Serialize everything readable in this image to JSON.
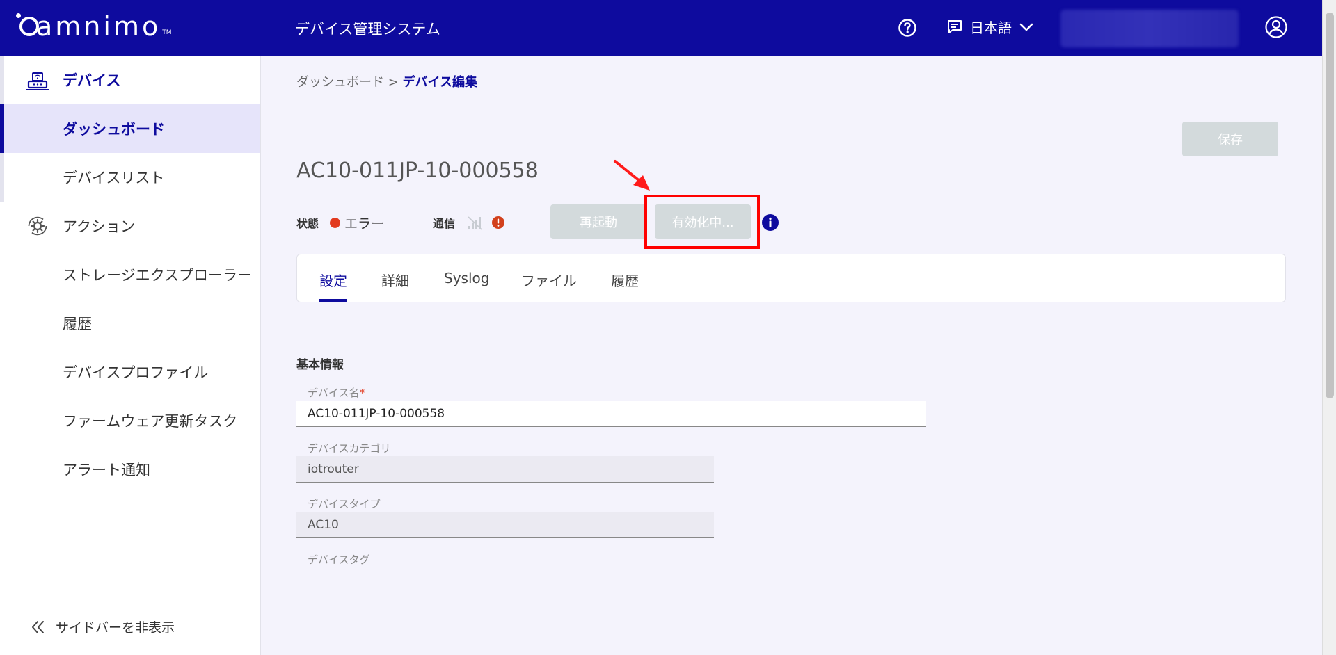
{
  "header": {
    "logo_text": "amnimo",
    "logo_tm": "TM",
    "app_title": "デバイス管理システム",
    "language": "日本語"
  },
  "sidebar": {
    "items": [
      {
        "label": "デバイス",
        "icon": "router-icon"
      },
      {
        "label": "ダッシュボード"
      },
      {
        "label": "デバイスリスト"
      },
      {
        "label": "アクション",
        "icon": "gear-cycle-icon"
      },
      {
        "label": "ストレージエクスプローラー"
      },
      {
        "label": "履歴"
      },
      {
        "label": "デバイスプロファイル"
      },
      {
        "label": "ファームウェア更新タスク"
      },
      {
        "label": "アラート通知"
      }
    ],
    "hide_label": "サイドバーを非表示"
  },
  "breadcrumb": {
    "parent": "ダッシュボード",
    "separator": " > ",
    "current": "デバイス編集"
  },
  "save_label": "保存",
  "device_title": "AC10-011JP-10-000558",
  "status": {
    "label": "状態",
    "value": "エラー",
    "dot_color": "#e23a1f",
    "comm_label": "通信"
  },
  "actions": {
    "reboot_label": "再起動",
    "enable_label": "有効化中..."
  },
  "tabs": [
    "設定",
    "詳細",
    "Syslog",
    "ファイル",
    "履歴"
  ],
  "form": {
    "section_title": "基本情報",
    "device_name_label": "デバイス名",
    "required_mark": "*",
    "device_name_value": "AC10-011JP-10-000558",
    "category_label": "デバイスカテゴリ",
    "category_value": "iotrouter",
    "type_label": "デバイスタイプ",
    "type_value": "AC10",
    "tag_label": "デバイスタグ",
    "tag_value": ""
  },
  "colors": {
    "brand": "#0e0b9e",
    "highlight": "#ff0000"
  }
}
